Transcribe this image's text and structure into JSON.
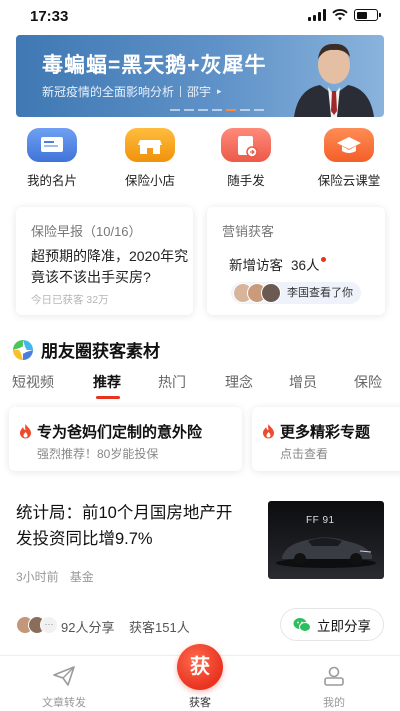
{
  "status_bar": {
    "time": "17:33"
  },
  "banner": {
    "title": "毒蝙蝠=黑天鹅+灰犀牛",
    "subtitle": "新冠疫情的全面影响分析",
    "author": "邵宇",
    "arrow": "▸"
  },
  "quick_actions": [
    {
      "label": "我的名片",
      "icon": "business-card-icon",
      "color": "#4a7fe0"
    },
    {
      "label": "保险小店",
      "icon": "shop-icon",
      "color": "#f29a1a"
    },
    {
      "label": "随手发",
      "icon": "share-document-icon",
      "color": "#f06a5a"
    },
    {
      "label": "保险云课堂",
      "icon": "graduation-cap-icon",
      "color": "#ff6a3a"
    }
  ],
  "news_card": {
    "title": "保险早报（10/16）",
    "text": "超预期的降准，2020年究竟该不该出手买房?",
    "footer": "今日已获客 32万"
  },
  "marketing_card": {
    "title": "营销获客",
    "visitor_label": "新增访客",
    "visitor_count": "36人",
    "pill_text": "李国查看了你"
  },
  "section": {
    "title": "朋友圈获客素材"
  },
  "tabs": [
    "短视频",
    "推荐",
    "热门",
    "理念",
    "增员",
    "保险"
  ],
  "topics": [
    {
      "title": "专为爸妈们定制的意外险",
      "subtitle": "强烈推荐！80岁能投保"
    },
    {
      "title": "更多精彩专题",
      "subtitle": "点击查看"
    }
  ],
  "article": {
    "title": "统计局：前10个月国房地产开发投资同比增9.7%",
    "time": "3小时前",
    "tag": "基金",
    "thumb_logo": "FF 91"
  },
  "share_row": {
    "more": "···",
    "share_count": "92人分享",
    "lead_count": "获客151人",
    "button_label": "立即分享"
  },
  "tabbar": {
    "items": [
      {
        "label": "文章转发"
      },
      {
        "label": "获客",
        "badge": "获"
      },
      {
        "label": "我的"
      }
    ]
  },
  "colors": {
    "accent": "#e8331f",
    "banner": "#4f86c0"
  }
}
